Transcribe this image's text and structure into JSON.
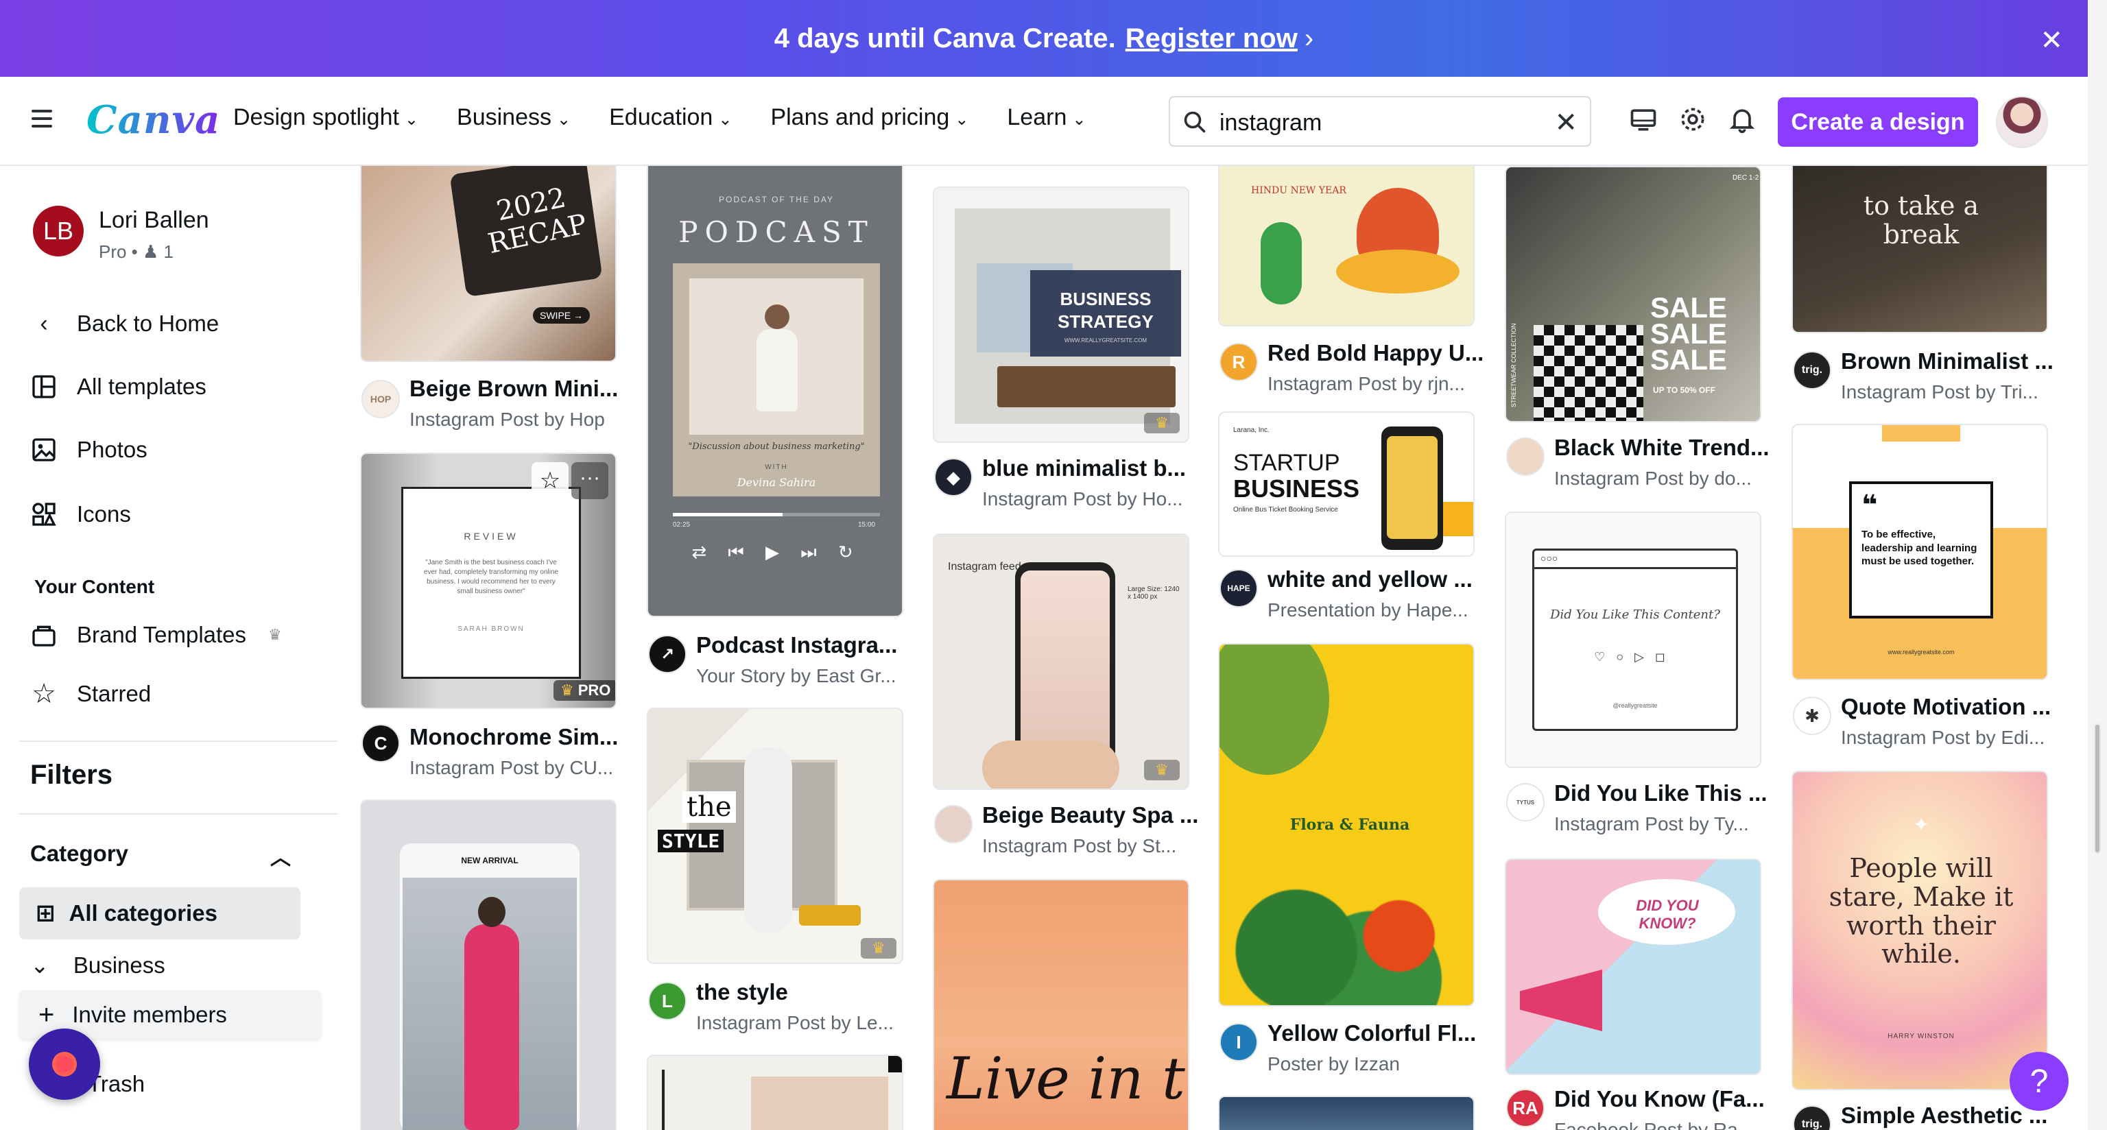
{
  "banner": {
    "text": "4 days until Canva Create.",
    "link": "Register now"
  },
  "header": {
    "logo": "Canva",
    "nav": [
      {
        "label": "Design spotlight"
      },
      {
        "label": "Business"
      },
      {
        "label": "Education"
      },
      {
        "label": "Plans and pricing"
      },
      {
        "label": "Learn"
      }
    ],
    "search_value": "instagram",
    "create_button": "Create a design"
  },
  "sidebar": {
    "user_initials": "LB",
    "user_name": "Lori Ballen",
    "user_plan": "Pro • ♟ 1",
    "back_home": "Back to Home",
    "all_templates": "All templates",
    "photos": "Photos",
    "icons": "Icons",
    "your_content": "Your Content",
    "brand_templates": "Brand Templates",
    "starred": "Starred",
    "filters": "Filters",
    "category": "Category",
    "all_categories": "All categories",
    "business": "Business",
    "invite_members": "Invite members",
    "trash": "Trash"
  },
  "cards": {
    "c1": {
      "title": "Beige Brown Mini...",
      "sub": "Instagram Post by Hop",
      "av": "HOP",
      "thumb_text": "2022 RECAP",
      "swipe": "SWIPE →"
    },
    "c2": {
      "title": "Monochrome Sim...",
      "sub": "Instagram Post by CU...",
      "av": "C",
      "review": "REVIEW",
      "quote": "\"Jane Smith is the best business coach I've ever had, completely transforming my online business. I would recommend her to every small business owner\"",
      "name": "SARAH BROWN",
      "pro": "PRO"
    },
    "c3": {
      "new_arrival": "NEW ARRIVAL"
    },
    "c4": {
      "title": "Podcast Instagra...",
      "sub": "Your Story by East Gr...",
      "small": "PODCAST OF THE DAY",
      "big": "PODCAST",
      "quote": "\"Discussion about business marketing\"",
      "with": "WITH",
      "host": "Devina Sahira",
      "t0": "02:25",
      "t1": "15:00"
    },
    "c5": {
      "title": "the style",
      "sub": "Instagram Post by Le...",
      "av": "L",
      "w1": "the",
      "w2": "STYLE"
    },
    "c6": {
      "title": "blue minimalist b...",
      "sub": "Instagram Post by Ho...",
      "overlay": "BUSINESS STRATEGY",
      "url": "WWW.REALLYGREATSITE.COM"
    },
    "c7": {
      "title": "Beige Beauty Spa ...",
      "sub": "Instagram Post by St...",
      "feed": "Instagram feed",
      "size": "Large Size: 1240 x 1400 px"
    },
    "c8": {
      "script": "Live in the"
    },
    "c9": {
      "title": "Red Bold Happy U...",
      "sub": "Instagram Post by rjn...",
      "av": "R",
      "label": "HINDU NEW YEAR"
    },
    "c10": {
      "title": "white and yellow ...",
      "sub": "Presentation by Hape...",
      "av": "HAPE",
      "l1": "STARTUP",
      "l2": "BUSINESS",
      "l3": "Online Bus Ticket Booking Service",
      "brand": "Larana, Inc."
    },
    "c11": {
      "title": "Yellow Colorful Fl...",
      "sub": "Poster by Izzan",
      "av": "I",
      "label": "Flora & Fauna"
    },
    "c12": {
      "title": "Black White Trend...",
      "sub": "Instagram Post by do...",
      "s": "SALE",
      "up": "UP TO 50% OFF",
      "side": "STREETWEAR COLLECTION",
      "dec": "DEC 1-2"
    },
    "c13": {
      "title": "Did You Like This ...",
      "sub": "Instagram Post by Ty...",
      "q": "Did You Like This Content?",
      "url": "@reallygreatsite"
    },
    "c14": {
      "title": "Did You Know (Fa...",
      "sub": "Facebook Post by Ra...",
      "av": "RA",
      "bubble": "DID YOU KNOW?"
    },
    "c15": {
      "title": "Brown Minimalist ...",
      "sub": "Instagram Post by Tri...",
      "av": "trig.",
      "t": "to take a break"
    },
    "c16": {
      "title": "Quote Motivation ...",
      "sub": "Instagram Post by Edi...",
      "q": "To be effective, leadership and learning must be used together.",
      "url": "www.reallygreatsite.com"
    },
    "c17": {
      "title": "Simple Aesthetic ...",
      "av": "trig.",
      "q": "People will stare, Make it worth their while.",
      "by": "HARRY WINSTON"
    }
  }
}
